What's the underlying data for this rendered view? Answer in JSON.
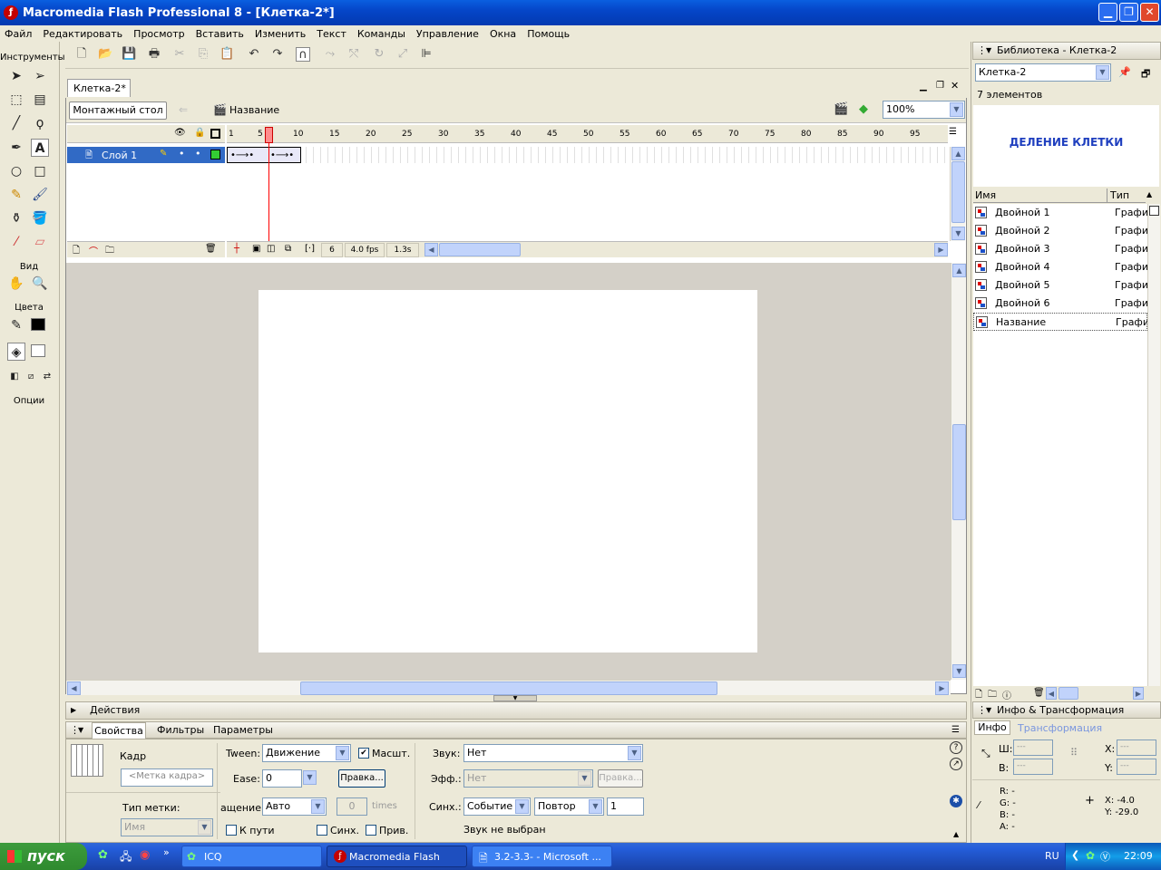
{
  "window": {
    "title": "Macromedia Flash Professional 8 - [Клетка-2*]"
  },
  "menu": [
    "Файл",
    "Редактировать",
    "Просмотр",
    "Вставить",
    "Изменить",
    "Текст",
    "Команды",
    "Управление",
    "Окна",
    "Помощь"
  ],
  "tools": {
    "title": "Инструменты",
    "view_label": "Вид",
    "colors_label": "Цвета",
    "options_label": "Опции"
  },
  "document": {
    "tab": "Клетка-2*",
    "stage_button": "Монтажный стол",
    "scene_name": "Название",
    "zoom": "100%"
  },
  "timeline": {
    "ruler": [
      "1",
      "5",
      "10",
      "15",
      "20",
      "25",
      "30",
      "35",
      "40",
      "45",
      "50",
      "55",
      "60",
      "65",
      "70",
      "75",
      "80",
      "85",
      "90",
      "95"
    ],
    "layer_name": "Слой 1",
    "current_frame": "6",
    "fps": "4.0 fps",
    "time": "1.3s"
  },
  "panels": {
    "actions": "Действия",
    "info_transform": "Инфо & Трансформация"
  },
  "properties": {
    "tabs": [
      "Свойства",
      "Фильтры",
      "Параметры"
    ],
    "frame_label": "Кадр",
    "frame_placeholder": "<Метка кадра>",
    "label_type": "Тип метки:",
    "label_type_value": "Имя",
    "tween_label": "Tween:",
    "tween_value": "Движение",
    "scale_label": "Масшт.",
    "ease_label": "Ease:",
    "ease_value": "0",
    "edit_button": "Правка...",
    "rotate_label": "ащение:",
    "rotate_value": "Авто",
    "times_value": "0",
    "times_label": "times",
    "to_path": "К пути",
    "sync": "Синх.",
    "snap": "Прив.",
    "sound_label": "Звук:",
    "sound_value": "Нет",
    "effect_label": "Эфф.:",
    "effect_value": "Нет",
    "effect_edit": "Правка...",
    "sync_label": "Синх.:",
    "sync_value": "Событие",
    "repeat_value": "Повтор",
    "repeat_count": "1",
    "no_sound": "Звук не выбран"
  },
  "library": {
    "title": "Библиотека - Клетка-2",
    "doc_select": "Клетка-2",
    "count": "7 элементов",
    "preview_text": "ДЕЛЕНИЕ КЛЕТКИ",
    "col_name": "Имя",
    "col_type": "Тип",
    "items": [
      {
        "name": "Двойной 1",
        "type": "Графи"
      },
      {
        "name": "Двойной 2",
        "type": "Графи"
      },
      {
        "name": "Двойной 3",
        "type": "Графи"
      },
      {
        "name": "Двойной 4",
        "type": "Графи"
      },
      {
        "name": "Двойной 5",
        "type": "Графи"
      },
      {
        "name": "Двойной 6",
        "type": "Графи"
      },
      {
        "name": "Название",
        "type": "Графи"
      }
    ]
  },
  "info": {
    "tabs": [
      "Инфо",
      "Трансформация"
    ],
    "w_label": "Ш:",
    "h_label": "В:",
    "x_label": "X:",
    "y_label": "Y:",
    "dash": "---",
    "r": "R: -",
    "g": "G: -",
    "b": "B: -",
    "a": "A: -",
    "x_val": "X:  -4.0",
    "y_val": "Y:  -29.0"
  },
  "taskbar": {
    "start": "пуск",
    "tasks": [
      "ICQ",
      "Macromedia Flash Pro...",
      "3.2-3.3- - Microsoft ..."
    ],
    "lang": "RU",
    "clock": "22:09"
  },
  "colors": {
    "accent": "#316ac5",
    "playhead": "#ff0000",
    "preview_text": "#1f3fbf"
  }
}
